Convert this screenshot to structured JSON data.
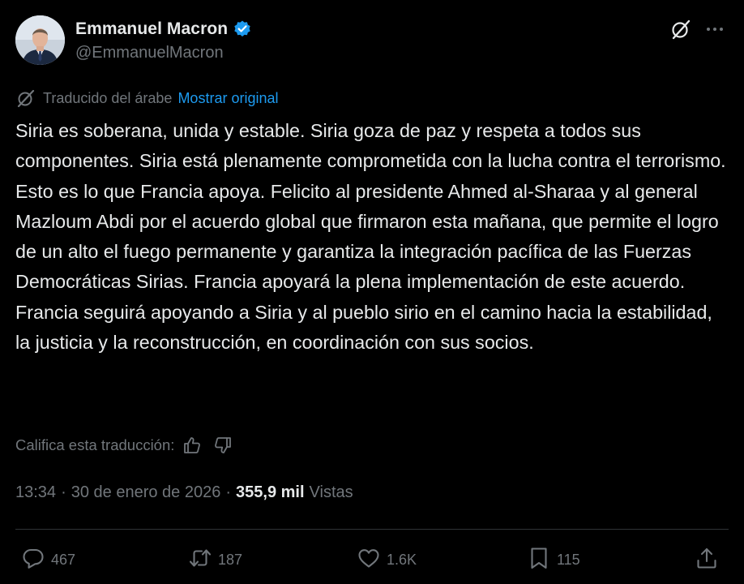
{
  "user": {
    "display_name": "Emmanuel Macron",
    "handle": "@EmmanuelMacron",
    "verified": true,
    "verified_color": "#1d9bf0"
  },
  "header_icons": {
    "grok": "grok-icon",
    "more": "more-icon"
  },
  "translation": {
    "label": "Traducido del árabe",
    "show_original": "Mostrar original",
    "link_color": "#1d9bf0"
  },
  "tweet": {
    "text": "Siria es soberana, unida y estable. Siria goza de paz y respeta a todos sus componentes. Siria está plenamente comprometida con la lucha contra el terrorismo. Esto es lo que Francia apoya. Felicito al presidente Ahmed al-Sharaa y al general Mazloum Abdi por el acuerdo global que firmaron esta mañana, que permite el logro de un alto el fuego permanente y garantiza la integración pacífica de las Fuerzas Democráticas Sirias. Francia apoyará la plena implementación de este acuerdo. Francia seguirá apoyando a Siria y al pueblo sirio en el camino hacia la estabilidad, la justicia y la reconstrucción, en coordinación con sus socios."
  },
  "rate": {
    "label": "Califica esta traducción:",
    "up_icon": "thumbs-up-icon",
    "down_icon": "thumbs-down-icon"
  },
  "meta": {
    "time": "13:34",
    "date": "30 de enero de 2026",
    "views_count": "355,9 mil",
    "views_label": "Vistas"
  },
  "actions": {
    "replies": "467",
    "reposts": "187",
    "likes": "1.6K",
    "bookmarks": "115"
  },
  "colors": {
    "background": "#000000",
    "text": "#e7e9ea",
    "secondary": "#71767b",
    "divider": "#2f3336"
  }
}
